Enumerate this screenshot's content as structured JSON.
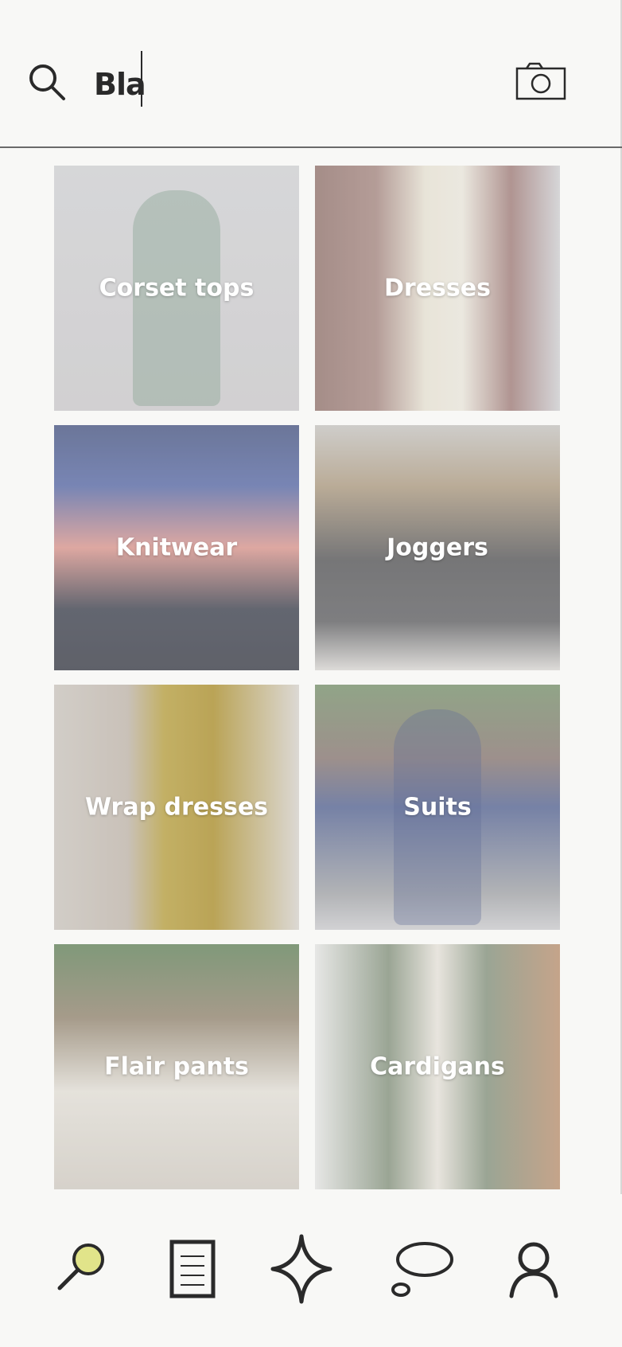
{
  "search": {
    "value": "Bla"
  },
  "categories": [
    {
      "label": "Corset tops"
    },
    {
      "label": "Dresses"
    },
    {
      "label": "Knitwear"
    },
    {
      "label": "Joggers"
    },
    {
      "label": "Wrap dresses"
    },
    {
      "label": "Suits"
    },
    {
      "label": "Flair pants"
    },
    {
      "label": "Cardigans"
    }
  ],
  "bottom_nav": {
    "items": [
      {
        "icon": "search-icon",
        "active": true
      },
      {
        "icon": "document-icon"
      },
      {
        "icon": "sparkle-icon"
      },
      {
        "icon": "chat-bubble-icon"
      },
      {
        "icon": "profile-icon"
      }
    ]
  },
  "colors": {
    "accent": "#e1e48a",
    "ink": "#2a2a2a",
    "background": "#f8f8f6"
  }
}
